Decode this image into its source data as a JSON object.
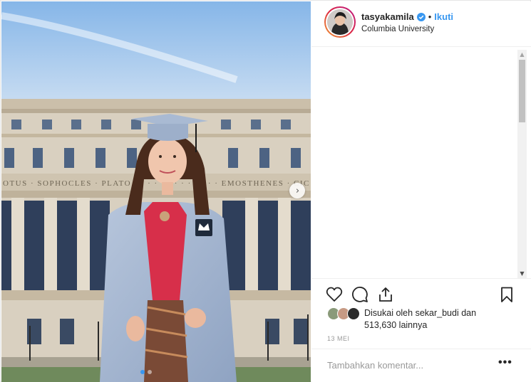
{
  "profile": {
    "username": "tasyakamila",
    "separator": "•",
    "follow_label": "Ikuti",
    "location": "Columbia University",
    "verified_icon": "verified-badge-icon",
    "accent": "#3897f0"
  },
  "photo": {
    "alt_icon_next": "chevron-right-icon",
    "frieze_text": "OTUS · SOPHOCLES · PLATO · ARIS · EMOSTHENES · CIC",
    "carousel_count": 2,
    "carousel_active": 0
  },
  "actions": {
    "like_icon": "heart-icon",
    "comment_icon": "comment-icon",
    "share_icon": "share-icon",
    "save_icon": "bookmark-icon"
  },
  "likes": {
    "prefix": "Disukai oleh",
    "user": "sekar_budi",
    "conjunction": "dan",
    "count": "513,630",
    "suffix": "lainnya"
  },
  "date": "13 MEI",
  "comment": {
    "placeholder": "Tambahkan komentar...",
    "more_label": "•••"
  }
}
